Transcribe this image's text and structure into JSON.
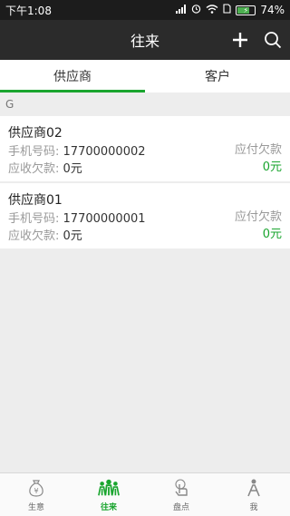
{
  "status_bar": {
    "time": "下午1:08",
    "battery": "74%",
    "battery_level": 0.74
  },
  "app_bar": {
    "title": "往来",
    "add_icon": "plus-icon",
    "search_icon": "search-icon"
  },
  "tabs": [
    {
      "label": "供应商",
      "active": true
    },
    {
      "label": "客户",
      "active": false
    }
  ],
  "section_letter": "G",
  "suppliers": [
    {
      "name": "供应商02",
      "phone_label": "手机号码:",
      "phone": "17700000002",
      "receivable_label": "应收欠款:",
      "receivable": "0元",
      "payable_label": "应付欠款",
      "payable": "0元"
    },
    {
      "name": "供应商01",
      "phone_label": "手机号码:",
      "phone": "17700000001",
      "receivable_label": "应收欠款:",
      "receivable": "0元",
      "payable_label": "应付欠款",
      "payable": "0元"
    }
  ],
  "bottom_nav": [
    {
      "label": "生意",
      "icon": "money-bag-icon",
      "active": false
    },
    {
      "label": "往来",
      "icon": "people-icon",
      "active": true
    },
    {
      "label": "盘点",
      "icon": "touch-icon",
      "active": false
    },
    {
      "label": "我",
      "icon": "person-icon",
      "active": false
    }
  ],
  "colors": {
    "accent": "#1aa52f",
    "app_bar": "#2b2b2b",
    "status_bar": "#1c1c1c"
  }
}
